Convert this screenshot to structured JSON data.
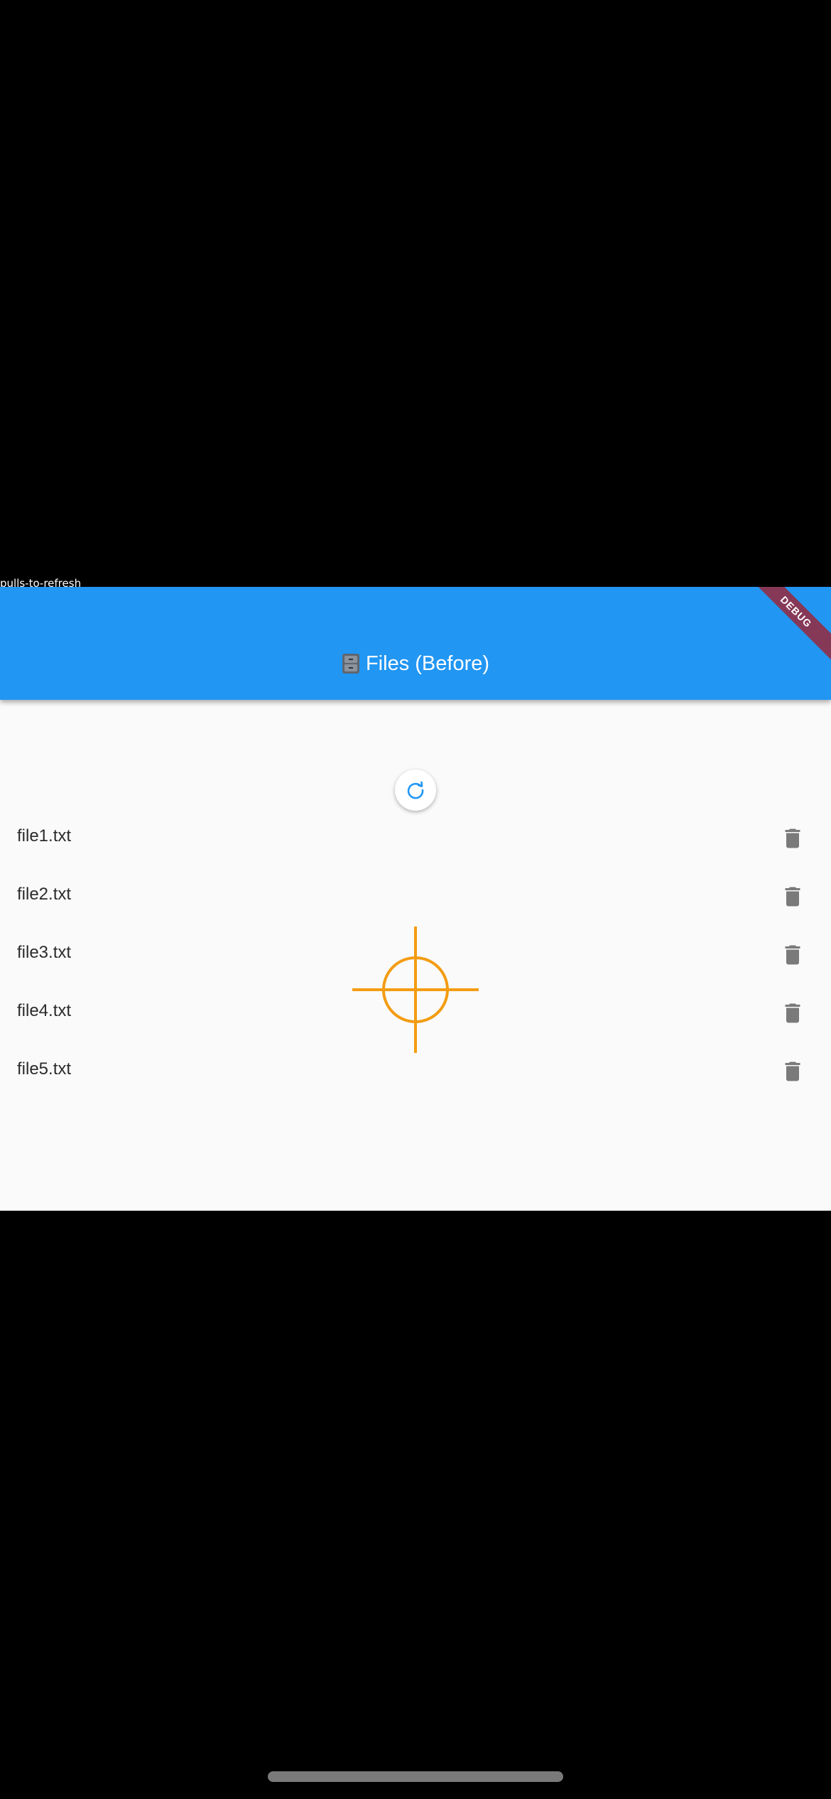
{
  "caption": "pulls-to-refresh",
  "appbar": {
    "title": "Files (Before)",
    "title_icon": "file-cabinet-icon",
    "debug_banner": "DEBUG"
  },
  "refresh_indicator": {
    "icon": "refresh-icon"
  },
  "files": [
    {
      "name": "file1.txt",
      "action_icon": "trash-icon"
    },
    {
      "name": "file2.txt",
      "action_icon": "trash-icon"
    },
    {
      "name": "file3.txt",
      "action_icon": "trash-icon"
    },
    {
      "name": "file4.txt",
      "action_icon": "trash-icon"
    },
    {
      "name": "file5.txt",
      "action_icon": "trash-icon"
    }
  ],
  "colors": {
    "appbar": "#2196f3",
    "background": "#fafafa",
    "crosshair": "#f39c12",
    "icon": "#7a7a7a"
  }
}
